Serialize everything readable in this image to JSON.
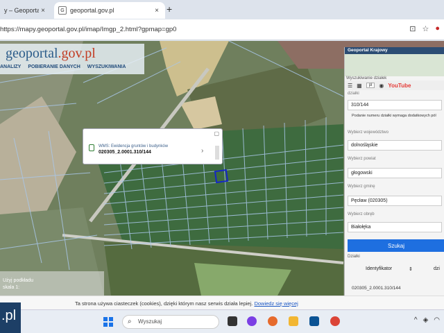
{
  "browser": {
    "tabs": [
      {
        "title": "y – Geoportal Kr",
        "active": false
      },
      {
        "title": "geoportal.gov.pl",
        "active": true
      }
    ],
    "url": "https://mapy.geoportal.gov.pl/imap/Imgp_2.html?gpmap=gp0"
  },
  "site": {
    "logo_main": "geoportal",
    "logo_suffix": ".gov.pl",
    "menu": [
      "ANALIZY",
      "POBIERANIE DANYCH",
      "WYSZUKIWANIA"
    ]
  },
  "popup": {
    "title": "WMS: Ewidencja gruntów i budynków",
    "value": "020305_2.0001.310/144"
  },
  "scale": {
    "line1": "Użyj podkładu",
    "line2": "skala 1:"
  },
  "panel": {
    "header": "Geoportal Krajowy",
    "sub": "Wyszukiwanie działek",
    "toolbar_select": "pl",
    "toolbar_youtube": "YouTube",
    "fields": [
      {
        "label": "działki",
        "value": "310/144"
      },
      {
        "label": "Wybierz województwo",
        "value": "dolnośląskie"
      },
      {
        "label": "Wybierz powiat",
        "value": "głogowski"
      },
      {
        "label": "Wybierz gminę",
        "value": "Pęcław (020305)"
      },
      {
        "label": "Wybierz obręb",
        "value": "Białołęka"
      }
    ],
    "hint": "Podanie numeru działki wymaga dodatkowych pól",
    "search_button": "Szukaj",
    "results_label": "Działki",
    "col_identyfikator": "Identyfikator",
    "col_dz": "dzi",
    "result_row": "020305_2.0001.310/144"
  },
  "cookie": {
    "text": "Ta strona używa ciasteczek (cookies), dzięki którym nasz serwis działa lepiej.",
    "link": "Dowiedz się więcej"
  },
  "badge": ".pl",
  "taskbar": {
    "search_placeholder": "Wyszukaj"
  }
}
